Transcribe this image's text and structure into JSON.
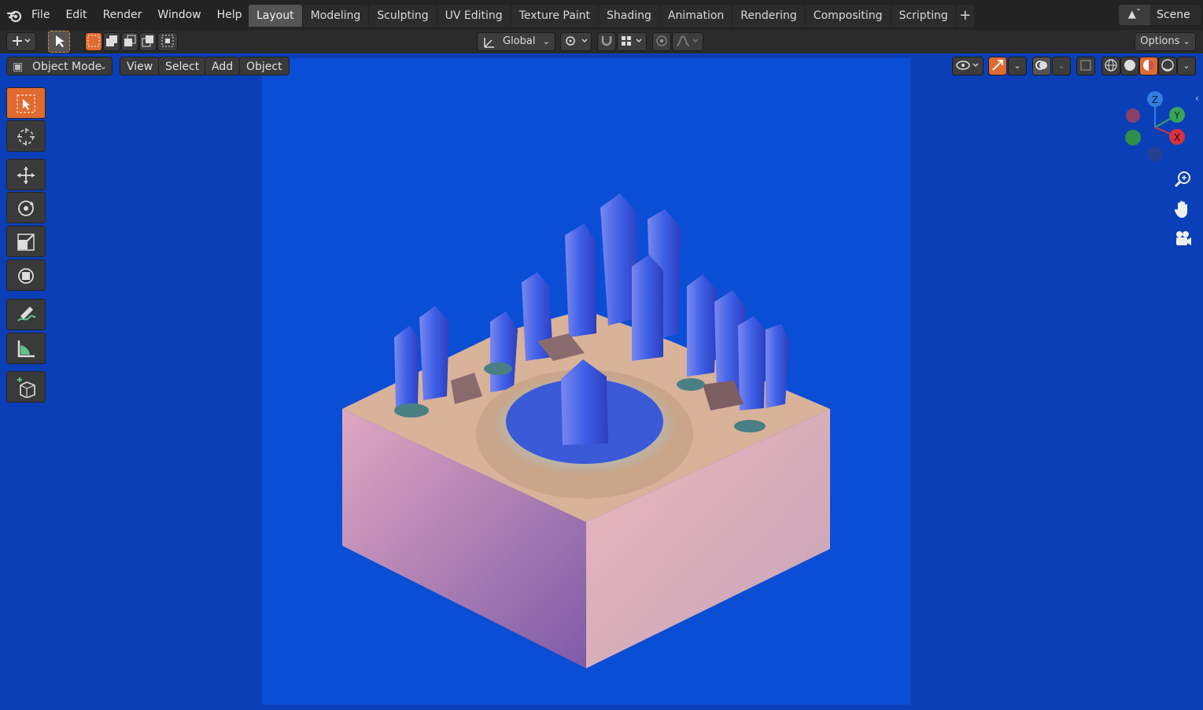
{
  "menu": [
    "File",
    "Edit",
    "Render",
    "Window",
    "Help"
  ],
  "workspace_tabs": [
    {
      "label": "Layout",
      "active": true
    },
    {
      "label": "Modeling",
      "active": false
    },
    {
      "label": "Sculpting",
      "active": false
    },
    {
      "label": "UV Editing",
      "active": false
    },
    {
      "label": "Texture Paint",
      "active": false
    },
    {
      "label": "Shading",
      "active": false
    },
    {
      "label": "Animation",
      "active": false
    },
    {
      "label": "Rendering",
      "active": false
    },
    {
      "label": "Compositing",
      "active": false
    },
    {
      "label": "Scripting",
      "active": false
    }
  ],
  "add_workspace_label": "+",
  "scene": {
    "label": "Scene"
  },
  "tool_header": {
    "orientation": "Global",
    "options_label": "Options"
  },
  "viewport_header": {
    "mode": "Object Mode",
    "menus": [
      "View",
      "Select",
      "Add",
      "Object"
    ]
  },
  "gizmo": {
    "z": "Z",
    "y": "Y",
    "x": "X"
  },
  "colors": {
    "accent": "#e06a30",
    "viewport_bg": "#0b3fb8",
    "render_bg": "#0a4ed6",
    "axis_x": "#d8323f",
    "axis_y": "#3aa35a",
    "axis_z": "#2f7fe0"
  },
  "tools": [
    {
      "name": "select-box-icon",
      "active": true
    },
    {
      "name": "cursor-icon",
      "active": false
    },
    {
      "name": "move-icon",
      "active": false
    },
    {
      "name": "rotate-icon",
      "active": false
    },
    {
      "name": "scale-icon",
      "active": false
    },
    {
      "name": "transform-icon",
      "active": false
    },
    {
      "name": "annotate-icon",
      "active": false
    },
    {
      "name": "measure-icon",
      "active": false
    },
    {
      "name": "add-cube-icon",
      "active": false
    }
  ]
}
